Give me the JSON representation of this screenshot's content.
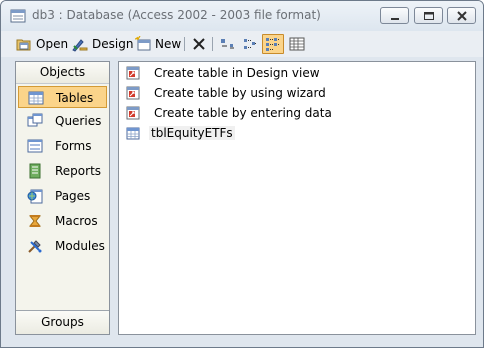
{
  "window": {
    "title": "db3 : Database (Access 2002 - 2003 file format)",
    "controls": [
      "minimize",
      "maximize",
      "close"
    ]
  },
  "toolbar": {
    "open_label": "Open",
    "design_label": "Design",
    "new_label": "New",
    "buttons": [
      "open",
      "design",
      "new",
      "delete",
      "large-icons",
      "small-icons",
      "list",
      "details"
    ],
    "active_view": "list"
  },
  "sidebar": {
    "header": "Objects",
    "footer": "Groups",
    "selected": "Tables",
    "items": [
      {
        "label": "Tables",
        "icon": "table-icon"
      },
      {
        "label": "Queries",
        "icon": "query-icon"
      },
      {
        "label": "Forms",
        "icon": "form-icon"
      },
      {
        "label": "Reports",
        "icon": "report-icon"
      },
      {
        "label": "Pages",
        "icon": "page-icon"
      },
      {
        "label": "Macros",
        "icon": "macro-icon"
      },
      {
        "label": "Modules",
        "icon": "module-icon"
      }
    ]
  },
  "objects": {
    "items": [
      {
        "label": "Create table in Design view",
        "icon": "shortcut-icon"
      },
      {
        "label": "Create table by using wizard",
        "icon": "shortcut-icon"
      },
      {
        "label": "Create table by entering data",
        "icon": "shortcut-icon"
      },
      {
        "label": "tblEquityETFs",
        "icon": "table-icon"
      }
    ]
  },
  "colors": {
    "selection": "#fbd48a",
    "selection_border": "#d39a35",
    "window_bg": "#dfe6ee",
    "sidebar_bg": "#f4f4ec"
  }
}
